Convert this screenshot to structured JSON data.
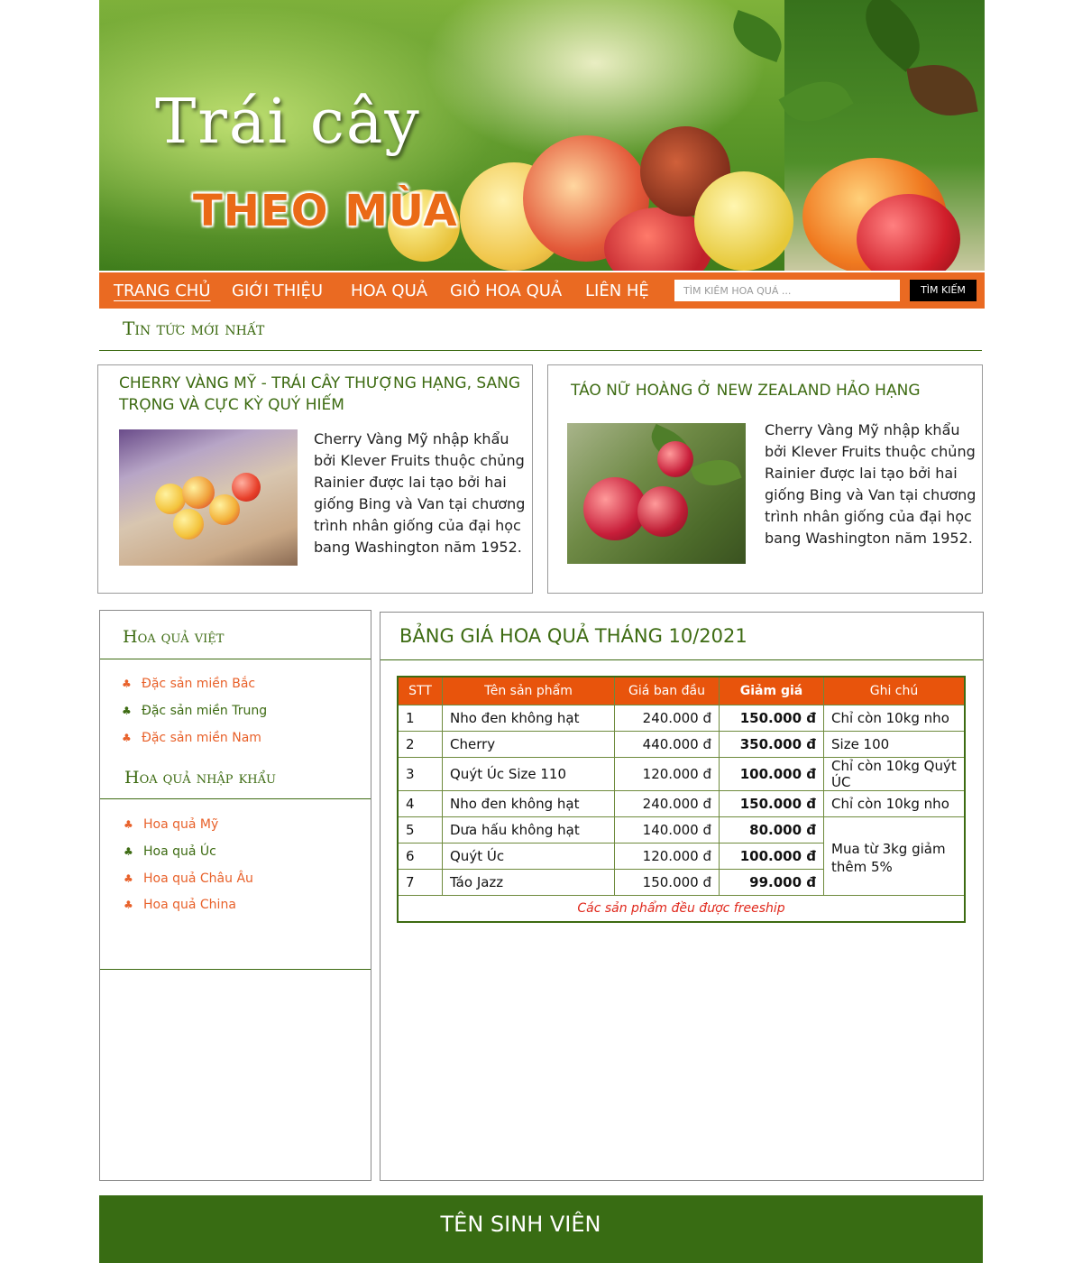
{
  "banner": {
    "title_line1": "Trái cây",
    "title_line2": "THEO MÙA"
  },
  "nav": {
    "items": [
      {
        "label": "TRANG CHỦ",
        "active": true
      },
      {
        "label": "GIỚI THIỆU",
        "active": false
      },
      {
        "label": "HOA QUẢ",
        "active": false
      },
      {
        "label": "GIỎ HOA QUẢ",
        "active": false
      },
      {
        "label": "LIÊN HỆ",
        "active": false
      }
    ],
    "search_placeholder": "TÌM KIẾM HOA QUẢ ...",
    "search_button": "TÌM KIẾM"
  },
  "news": {
    "heading": "Tin tức mới nhất",
    "cards": [
      {
        "title": "CHERRY VÀNG MỸ - TRÁI CÂY THƯỢNG HẠNG, SANG TRỌNG VÀ CỰC KỲ QUÝ HIẾM",
        "text": "Cherry Vàng Mỹ nhập khẩu bởi Klever Fruits thuộc chủng Rainier được lai tạo bởi hai giống Bing và Van tại chương trình nhân giống của đại học bang Washington năm 1952."
      },
      {
        "title": "TÁO NỮ HOÀNG Ở NEW ZEALAND HẢO HẠNG",
        "text": "Cherry Vàng Mỹ nhập khẩu bởi Klever Fruits thuộc chủng Rainier được lai tạo bởi hai giống Bing và Van tại chương trình nhân giống của đại học bang Washington năm 1952."
      }
    ]
  },
  "sidebar": {
    "group1": {
      "heading": "Hoa quả việt",
      "items": [
        {
          "label": "Đặc sản miền Bắc",
          "color": "#e8612a"
        },
        {
          "label": "Đặc sản miền Trung",
          "color": "#3d6b12"
        },
        {
          "label": "Đặc sản miền Nam",
          "color": "#e8612a"
        }
      ]
    },
    "group2": {
      "heading": "Hoa quả nhập khẩu",
      "items": [
        {
          "label": "Hoa quả Mỹ",
          "color": "#e8612a"
        },
        {
          "label": "Hoa quả Úc",
          "color": "#3d6b12"
        },
        {
          "label": "Hoa quả Châu Âu",
          "color": "#e8612a"
        },
        {
          "label": "Hoa quả China",
          "color": "#e8612a"
        }
      ]
    }
  },
  "main": {
    "title": "BẢNG GIÁ HOA QUẢ THÁNG 10/2021",
    "table": {
      "headers": [
        "STT",
        "Tên sản phẩm",
        "Giá ban đầu",
        "Giảm giá",
        "Ghi chú"
      ],
      "rows": [
        {
          "stt": "1",
          "name": "Nho đen không hạt",
          "price": "240.000 đ",
          "discount": "150.000 đ",
          "note": "Chỉ còn 10kg nho"
        },
        {
          "stt": "2",
          "name": "Cherry",
          "price": "440.000 đ",
          "discount": "350.000 đ",
          "note": "Size 100"
        },
        {
          "stt": "3",
          "name": "Quýt Úc Size 110",
          "price": "120.000 đ",
          "discount": "100.000 đ",
          "note": "Chỉ còn 10kg Quýt ÚC"
        },
        {
          "stt": "4",
          "name": "Nho đen không hạt",
          "price": "240.000 đ",
          "discount": "150.000 đ",
          "note": "Chỉ còn 10kg nho"
        },
        {
          "stt": "5",
          "name": "Dưa hấu không hạt",
          "price": "140.000 đ",
          "discount": "80.000 đ",
          "note": "Mua từ 3kg giảm thêm 5%"
        },
        {
          "stt": "6",
          "name": "Quýt Úc",
          "price": "120.000 đ",
          "discount": "100.000 đ",
          "note": ""
        },
        {
          "stt": "7",
          "name": "Táo Jazz",
          "price": "150.000 đ",
          "discount": "99.000 đ",
          "note": ""
        }
      ],
      "footnote": "Các sản phẩm đều được freeship"
    }
  },
  "footer": {
    "text": "TÊN SINH VIÊN"
  },
  "colors": {
    "brand_green": "#3d6b12",
    "nav_orange": "#ea6a22",
    "table_header": "#e8540c",
    "footer_green": "#386c13"
  }
}
